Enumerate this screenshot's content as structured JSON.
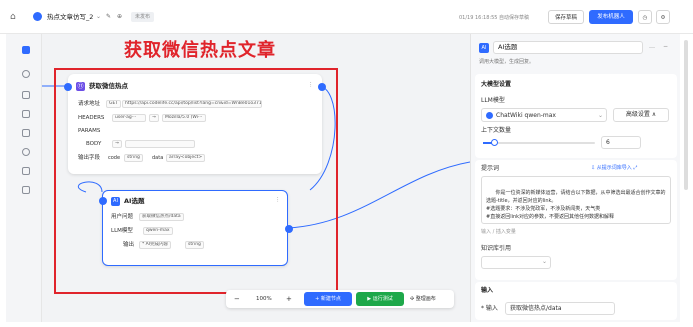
{
  "topbar": {
    "title": "热点文章仿写_2",
    "status": "未发布",
    "autosave": "01/19 16:18:55 自动保存草稿",
    "save_label": "保存草稿",
    "publish_label": "发布机器人"
  },
  "annotation": {
    "text": "获取微信热点文章",
    "color": "#e0242b"
  },
  "node_fetch": {
    "title": "获取微信热点",
    "url_label": "请求地址",
    "method": "GET",
    "url": "https://api.codelife.cc/api/top/list?lang=cn&id=WnBe01o371",
    "headers_label": "HEADERS",
    "header_key": "user-ag···",
    "header_value": "Mozilla/5.0 (Wi···",
    "params_label": "PARAMS",
    "body_label": "BODY",
    "output_label": "输出字段",
    "out1_name": "code",
    "out1_type": "string",
    "out2_name": "data",
    "out2_type": "array<object>"
  },
  "node_ai": {
    "title": "AI选题",
    "input_label": "用户问题",
    "input_value": "获取微信热点/data",
    "model_label": "LLM模型",
    "model_value": "qwen-max",
    "output_label": "输出",
    "output_value": "* AI完成内容",
    "output_type": "string"
  },
  "toolbar": {
    "zoom": "100%",
    "minus": "−",
    "plus": "+",
    "add_node": "+ 新建节点",
    "run_test": "▶ 运行测试",
    "tidy": "✣ 整理画布"
  },
  "panel": {
    "badge": "AI",
    "title": "AI选题",
    "subtitle": "调用大模型，生成回复。",
    "section_model": "大模型设置",
    "llm_label": "LLM模型",
    "llm_value": "ChatWiki qwen-max",
    "advanced": "高级设置 ∧",
    "context_label": "上下文数量",
    "context_value": "6",
    "prompt_label": "提示词",
    "prompt_import": "从提示词库导入",
    "prompt_text": "你是一位资深的新媒体运营，请结合以下数据，从中筛选出最适合创作文章的选题-title，并返回对应的link。\n#选题要求：不涉及党政军，不涉及新闻类，天气类\n#直接返回link对应的参数，不要返回其他任何数据和解释",
    "prompt_hint": "输入 / 插入变量",
    "kb_label": "知识库引用",
    "section_input": "输入",
    "input_label": "* 输入",
    "input_value": "获取微信热点/data"
  },
  "colors": {
    "accent": "#2f6bff",
    "node_purple": "#6c4ee6",
    "green": "#1ea84a"
  }
}
